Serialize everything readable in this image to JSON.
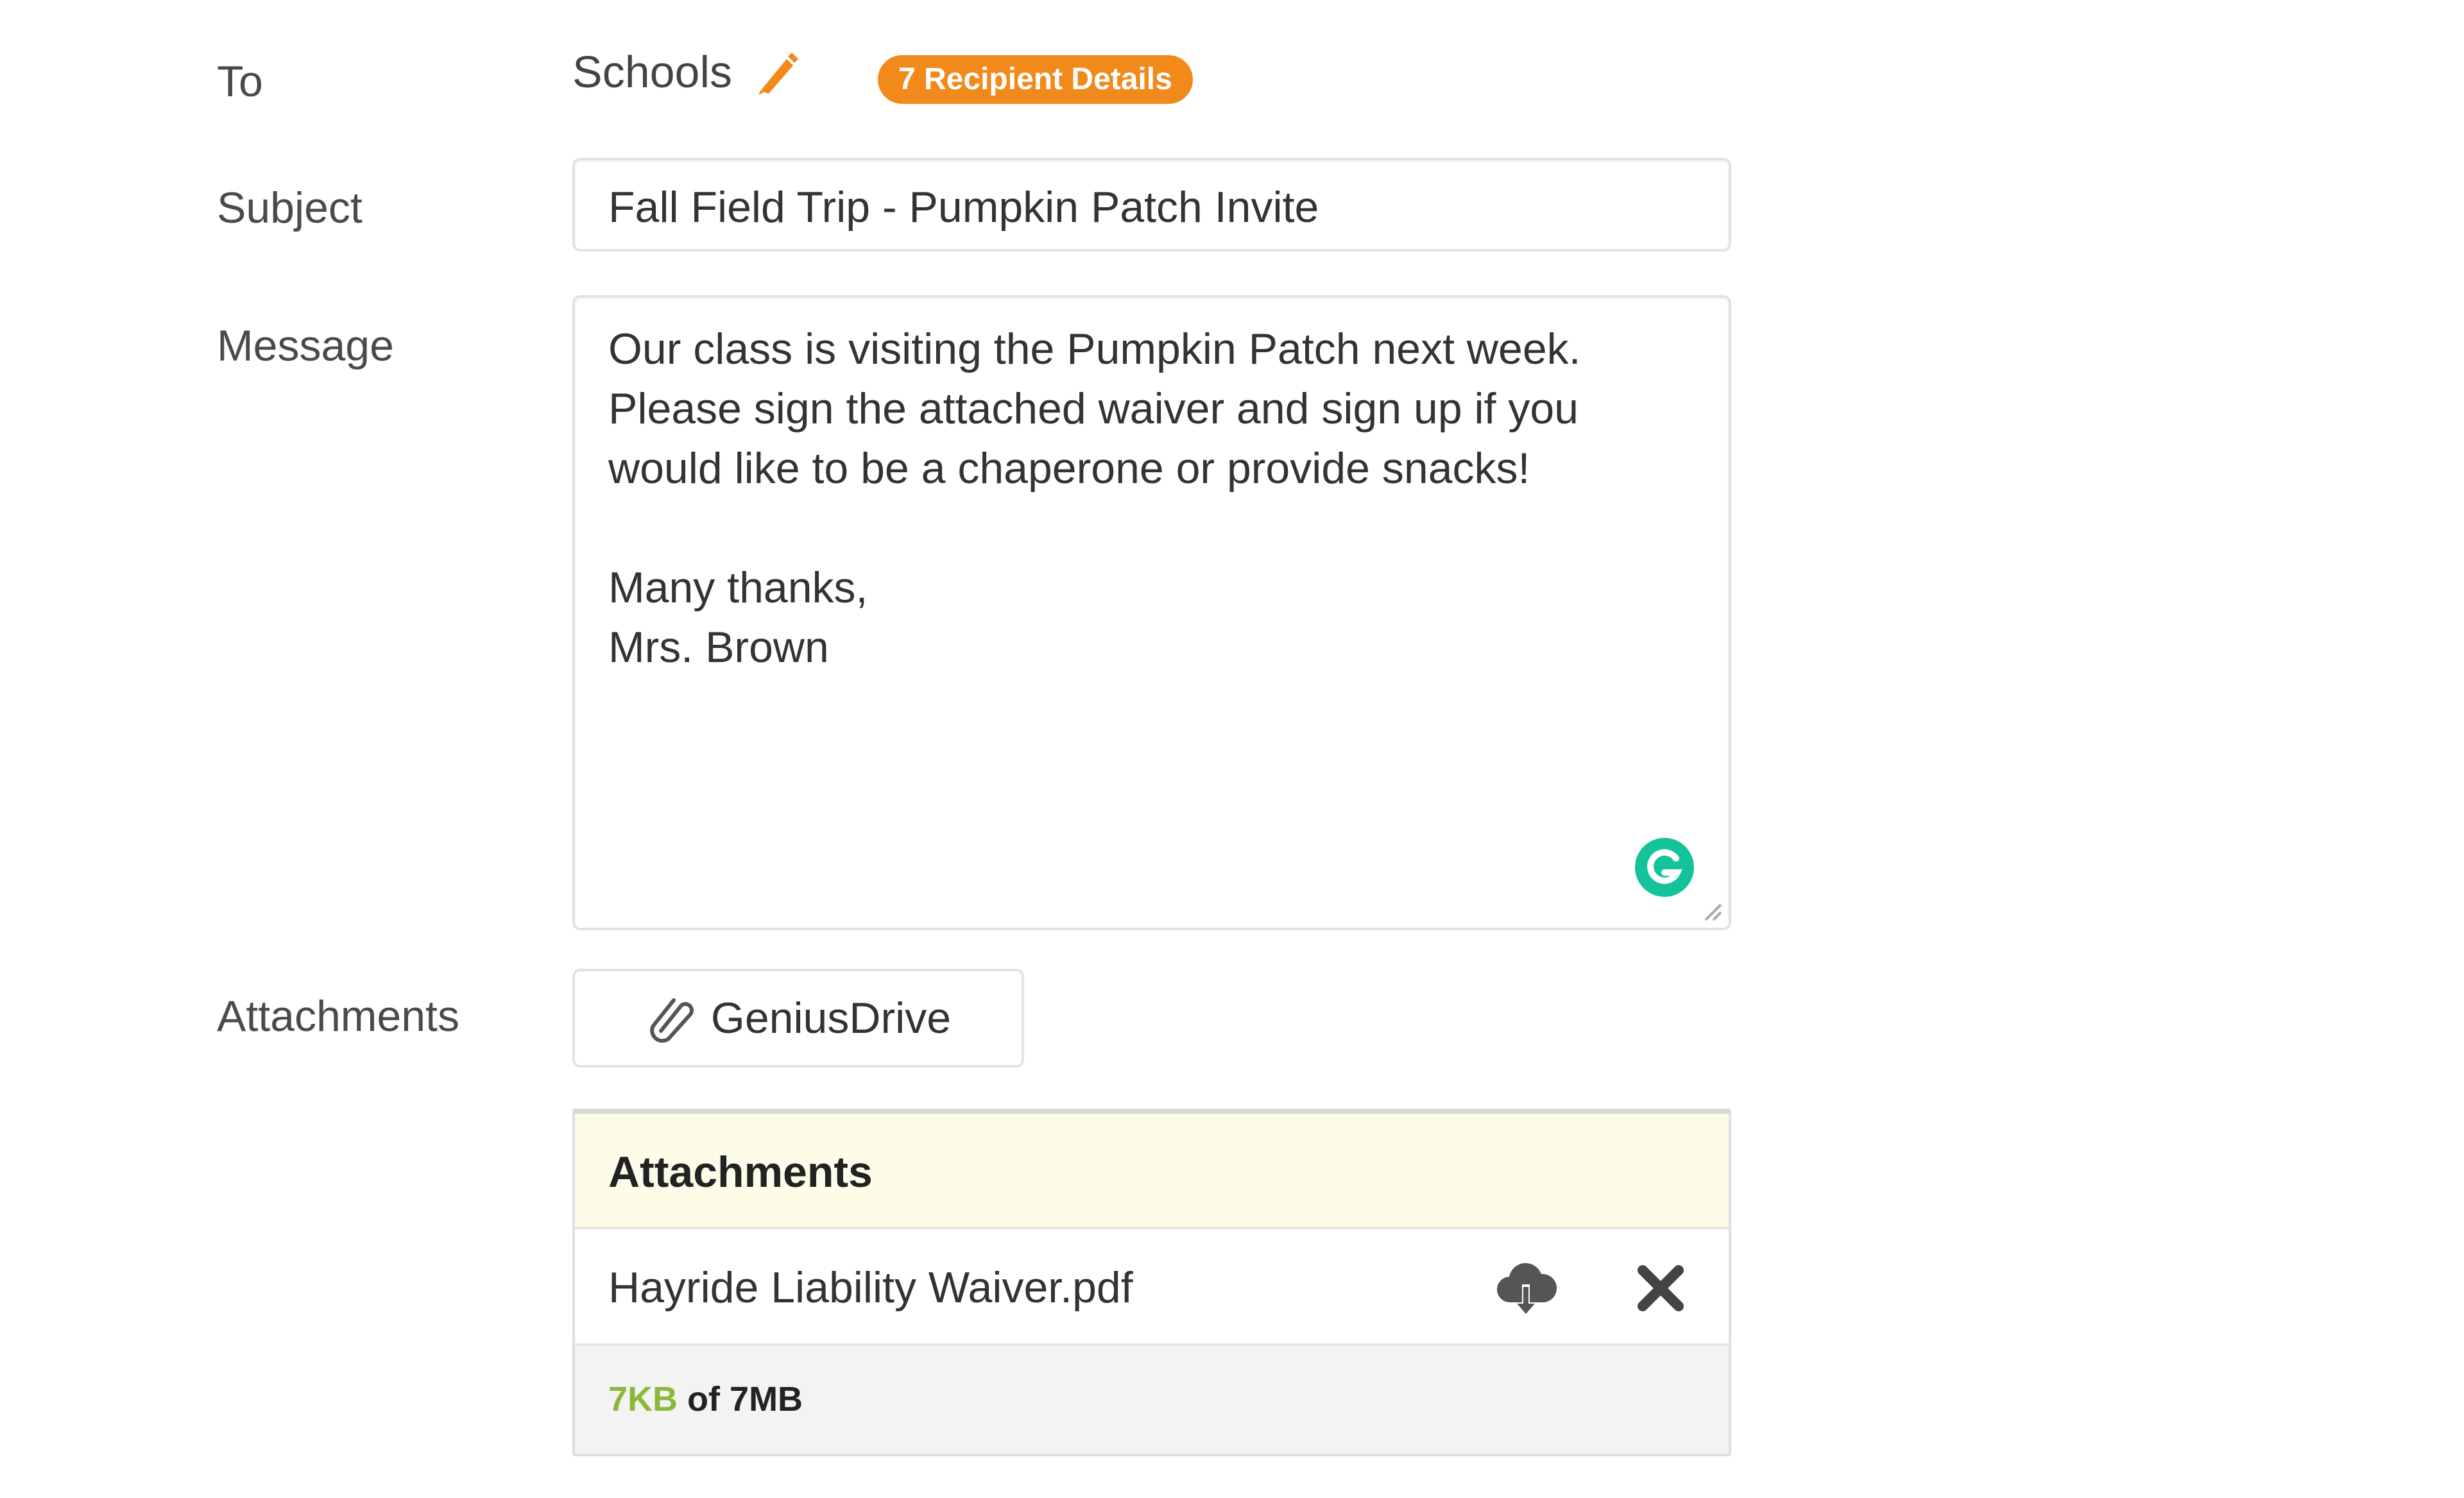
{
  "to": {
    "label": "To",
    "value": "Schools",
    "edit_icon": "pencil-icon",
    "badge": "7 Recipient Details"
  },
  "subject": {
    "label": "Subject",
    "value": "Fall Field Trip - Pumpkin Patch Invite"
  },
  "message": {
    "label": "Message",
    "lines": [
      "Our class is visiting the Pumpkin Patch next week.",
      "Please sign the attached waiver and sign up if you",
      "would like to be a chaperone or provide snacks!",
      "",
      "Many thanks,",
      "Mrs. Brown"
    ],
    "assistant_icon": "grammarly-icon"
  },
  "attachments": {
    "label": "Attachments",
    "drive_button": "GeniusDrive",
    "panel_title": "Attachments",
    "files": [
      {
        "name": "Hayride Liability Waiver.pdf"
      }
    ],
    "usage": {
      "used": "7KB",
      "of_text": "of",
      "limit": "7MB"
    }
  },
  "colors": {
    "accent_orange": "#f28a1b",
    "usage_green": "#8bb83a",
    "panel_header_bg": "#fcfce8",
    "grammarly_green": "#15c39a"
  }
}
